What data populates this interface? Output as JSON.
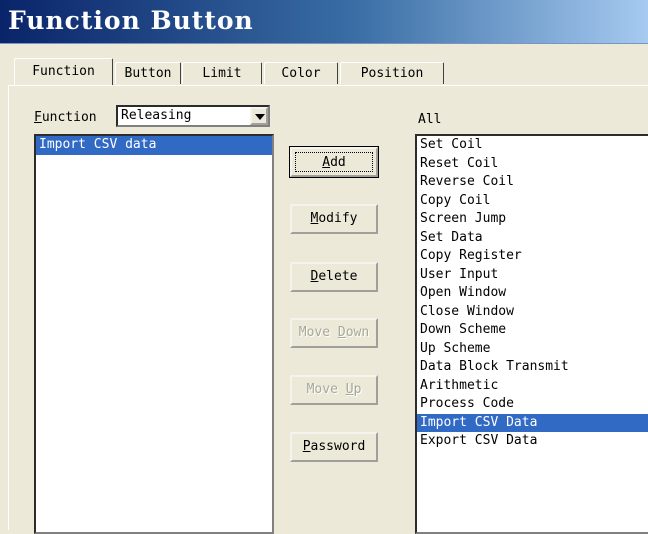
{
  "window": {
    "title": "Function Button"
  },
  "tabs": [
    {
      "label": "Function",
      "active": true
    },
    {
      "label": "Button"
    },
    {
      "label": "Limit"
    },
    {
      "label": "Color"
    },
    {
      "label": "Position"
    }
  ],
  "function_select": {
    "label": "Function",
    "label_hotkey": "F",
    "label_rest": "unction",
    "value": "Releasing"
  },
  "selected_list": {
    "items": [
      "Import CSV data"
    ],
    "selected_index": 0
  },
  "buttons": {
    "add": {
      "hotkey": "A",
      "rest": "dd"
    },
    "modify": {
      "hotkey": "M",
      "rest": "odify"
    },
    "delete": {
      "hotkey": "D",
      "rest": "elete"
    },
    "move_down": {
      "pre": "Move ",
      "hotkey": "D",
      "rest": "own"
    },
    "move_up": {
      "pre": "Move ",
      "hotkey": "U",
      "rest": "p"
    },
    "password": {
      "hotkey": "P",
      "rest": "assword"
    }
  },
  "all_list": {
    "label": "All",
    "items": [
      "Set Coil",
      "Reset Coil",
      "Reverse Coil",
      "Copy Coil",
      "Screen Jump",
      "Set Data",
      "Copy Register",
      "User Input",
      "Open Window",
      "Close Window",
      "Down Scheme",
      "Up Scheme",
      "Data Block Transmit",
      "Arithmetic",
      "Process Code",
      "Import CSV Data",
      "Export CSV Data"
    ],
    "selected_index": 15
  },
  "colors": {
    "selection": "#316ac5",
    "dialog_bg": "#ece9d8",
    "title_start": "#0a246a",
    "title_end": "#a6caf0"
  }
}
